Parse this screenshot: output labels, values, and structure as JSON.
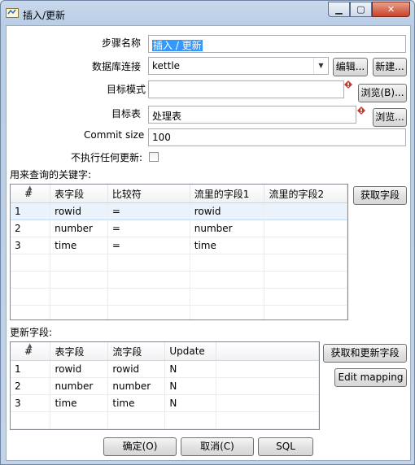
{
  "window": {
    "title": "插入/更新",
    "min_glyph": "▁",
    "max_glyph": "▢",
    "close_glyph": "✕"
  },
  "form": {
    "step_name_label": "步骤名称",
    "step_name_value": "插入 / 更新",
    "db_conn_label": "数据库连接",
    "db_conn_value": "kettle",
    "edit_button": "编辑...",
    "new_button": "新建...",
    "target_schema_label": "目标模式",
    "target_schema_value": "",
    "browse_b_button": "浏览(B)...",
    "target_table_label": "目标表",
    "target_table_value": "处理表",
    "browse_button": "浏览...",
    "commit_size_label": "Commit size",
    "commit_size_value": "100",
    "no_update_label": "不执行任何更新:",
    "no_update_checked": false
  },
  "keys": {
    "section_label": "用来查询的关键字:",
    "get_fields_button": "获取字段",
    "columns": [
      "#",
      "表字段",
      "比较符",
      "流里的字段1",
      "流里的字段2"
    ],
    "rows": [
      [
        "1",
        "rowid",
        "=",
        "rowid",
        ""
      ],
      [
        "2",
        "number",
        "=",
        "number",
        ""
      ],
      [
        "3",
        "time",
        "=",
        "time",
        ""
      ]
    ]
  },
  "update": {
    "section_label": "更新字段:",
    "get_update_fields_button": "获取和更新字段",
    "edit_mapping_button": "Edit mapping",
    "columns": [
      "#",
      "表字段",
      "流字段",
      "Update"
    ],
    "rows": [
      [
        "1",
        "rowid",
        "rowid",
        "N"
      ],
      [
        "2",
        "number",
        "number",
        "N"
      ],
      [
        "3",
        "time",
        "time",
        "N"
      ]
    ]
  },
  "footer": {
    "ok_button": "确定(O)",
    "cancel_button": "取消(C)",
    "sql_button": "SQL"
  }
}
